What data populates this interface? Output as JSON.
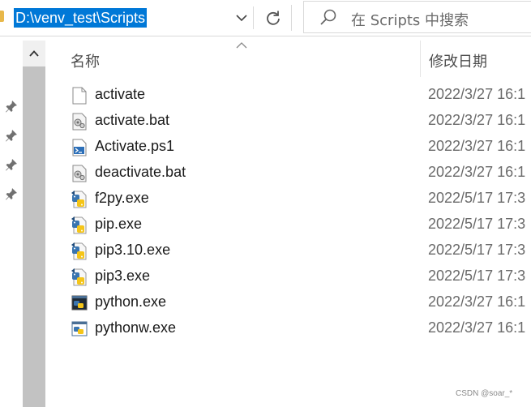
{
  "address_bar": {
    "path": "D:\\venv_test\\Scripts"
  },
  "search": {
    "placeholder": "在 Scripts 中搜索"
  },
  "columns": {
    "name": "名称",
    "date_modified": "修改日期"
  },
  "files": [
    {
      "name": "activate",
      "date": "2022/3/27 16:1",
      "icon": "blank-file-icon"
    },
    {
      "name": "activate.bat",
      "date": "2022/3/27 16:1",
      "icon": "batch-file-icon"
    },
    {
      "name": "Activate.ps1",
      "date": "2022/3/27 16:1",
      "icon": "powershell-file-icon"
    },
    {
      "name": "deactivate.bat",
      "date": "2022/3/27 16:1",
      "icon": "batch-file-icon"
    },
    {
      "name": "f2py.exe",
      "date": "2022/5/17 17:3",
      "icon": "python-exe-icon"
    },
    {
      "name": "pip.exe",
      "date": "2022/5/17 17:3",
      "icon": "python-exe-icon"
    },
    {
      "name": "pip3.10.exe",
      "date": "2022/5/17 17:3",
      "icon": "python-exe-icon"
    },
    {
      "name": "pip3.exe",
      "date": "2022/5/17 17:3",
      "icon": "python-exe-icon"
    },
    {
      "name": "python.exe",
      "date": "2022/3/27 16:1",
      "icon": "python-console-icon"
    },
    {
      "name": "pythonw.exe",
      "date": "2022/3/27 16:1",
      "icon": "python-window-icon"
    }
  ],
  "watermark": "CSDN @soar_*",
  "colors": {
    "selection": "#0078d7",
    "folder": "#e8b84a",
    "python_blue": "#3a75b0",
    "python_yellow": "#f5c518"
  }
}
